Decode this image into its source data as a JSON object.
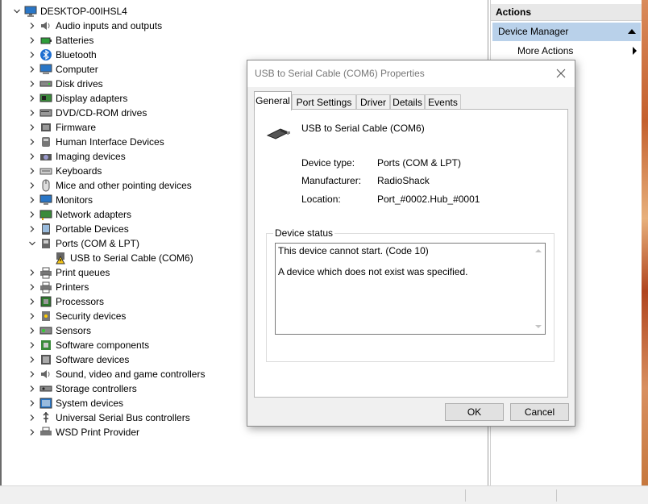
{
  "tree": {
    "root": "DESKTOP-00IHSL4",
    "items": [
      {
        "label": "Audio inputs and outputs",
        "icon": "speaker-icon"
      },
      {
        "label": "Batteries",
        "icon": "battery-icon"
      },
      {
        "label": "Bluetooth",
        "icon": "bluetooth-icon"
      },
      {
        "label": "Computer",
        "icon": "computer-icon"
      },
      {
        "label": "Disk drives",
        "icon": "disk-drive-icon"
      },
      {
        "label": "Display adapters",
        "icon": "display-adapter-icon"
      },
      {
        "label": "DVD/CD-ROM drives",
        "icon": "dvd-drive-icon"
      },
      {
        "label": "Firmware",
        "icon": "firmware-icon"
      },
      {
        "label": "Human Interface Devices",
        "icon": "hid-icon"
      },
      {
        "label": "Imaging devices",
        "icon": "camera-icon"
      },
      {
        "label": "Keyboards",
        "icon": "keyboard-icon"
      },
      {
        "label": "Mice and other pointing devices",
        "icon": "mouse-icon"
      },
      {
        "label": "Monitors",
        "icon": "monitor-icon"
      },
      {
        "label": "Network adapters",
        "icon": "network-adapter-icon"
      },
      {
        "label": "Portable Devices",
        "icon": "portable-device-icon"
      },
      {
        "label": "Ports (COM & LPT)",
        "icon": "port-icon"
      },
      {
        "label": "USB to Serial Cable (COM6)",
        "icon": "warning-port-icon"
      },
      {
        "label": "Print queues",
        "icon": "printer-icon"
      },
      {
        "label": "Printers",
        "icon": "printer-icon"
      },
      {
        "label": "Processors",
        "icon": "processor-icon"
      },
      {
        "label": "Security devices",
        "icon": "security-device-icon"
      },
      {
        "label": "Sensors",
        "icon": "sensor-icon"
      },
      {
        "label": "Software components",
        "icon": "software-component-icon"
      },
      {
        "label": "Software devices",
        "icon": "software-device-icon"
      },
      {
        "label": "Sound, video and game controllers",
        "icon": "speaker-icon"
      },
      {
        "label": "Storage controllers",
        "icon": "storage-controller-icon"
      },
      {
        "label": "System devices",
        "icon": "system-device-icon"
      },
      {
        "label": "Universal Serial Bus controllers",
        "icon": "usb-icon"
      },
      {
        "label": "WSD Print Provider",
        "icon": "wsd-icon"
      }
    ]
  },
  "actions": {
    "title": "Actions",
    "section": "Device Manager",
    "more": "More Actions"
  },
  "dialog": {
    "title": "USB to Serial Cable (COM6) Properties",
    "tabs": [
      "General",
      "Port Settings",
      "Driver",
      "Details",
      "Events"
    ],
    "device_name": "USB to Serial Cable (COM6)",
    "props": [
      {
        "label": "Device type:",
        "value": "Ports (COM & LPT)"
      },
      {
        "label": "Manufacturer:",
        "value": "RadioShack"
      },
      {
        "label": "Location:",
        "value": "Port_#0002.Hub_#0001"
      }
    ],
    "status_group": "Device status",
    "status_line1": "This device cannot start. (Code 10)",
    "status_line2": "A device which does not exist was specified.",
    "ok": "OK",
    "cancel": "Cancel"
  },
  "colors": {
    "selection": "#b9d1ea",
    "warning": "#f5c518"
  }
}
